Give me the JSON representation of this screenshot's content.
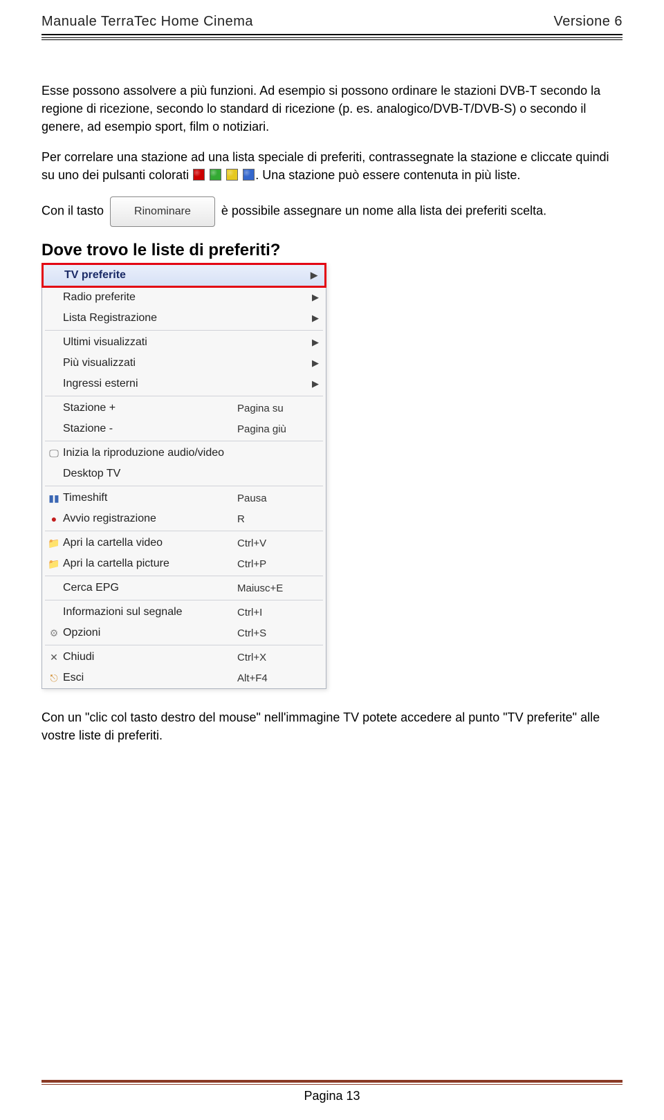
{
  "header": {
    "left": "Manuale TerraTec Home Cinema",
    "right": "Versione 6"
  },
  "paragraphs": {
    "p1": "Esse possono assolvere a più funzioni. Ad esempio si possono ordinare le stazioni DVB-T secondo la regione di ricezione, secondo lo standard di ricezione (p. es. analogico/DVB-T/DVB-S) o secondo il genere, ad esempio sport, film o notiziari.",
    "p2a": "Per correlare una stazione ad una lista speciale di preferiti, contrassegnate la stazione e cliccate quindi su uno dei pulsanti colorati ",
    "p2b": ". Una stazione può essere contenuta in più liste.",
    "p3a": "Con il tasto ",
    "p3b": " è possibile assegnare un nome alla lista dei preferiti scelta."
  },
  "button_label": "Rinominare",
  "heading": "Dove trovo le liste di preferiti?",
  "menu": {
    "tv_preferite": "TV preferite",
    "radio_preferite": "Radio preferite",
    "lista_reg": "Lista Registrazione",
    "ultimi": "Ultimi visualizzati",
    "piu": "Più visualizzati",
    "ingressi": "Ingressi esterni",
    "stazione_plus": "Stazione +",
    "stazione_minus": "Stazione -",
    "pagina_su": "Pagina su",
    "pagina_giu": "Pagina giù",
    "inizia_rip": "Inizia la riproduzione audio/video",
    "desktop_tv": "Desktop TV",
    "timeshift": "Timeshift",
    "avvio_reg": "Avvio registrazione",
    "pausa": "Pausa",
    "r": "R",
    "apri_video": "Apri la cartella video",
    "apri_picture": "Apri la cartella picture",
    "ctrlv": "Ctrl+V",
    "ctrlp": "Ctrl+P",
    "cerca_epg": "Cerca EPG",
    "maiusce": "Maiusc+E",
    "info_segnale": "Informazioni sul segnale",
    "opzioni": "Opzioni",
    "ctrli": "Ctrl+I",
    "ctrls": "Ctrl+S",
    "chiudi": "Chiudi",
    "esci": "Esci",
    "ctrlx": "Ctrl+X",
    "altf4": "Alt+F4"
  },
  "p_after": "Con un \"clic col tasto destro del mouse\" nell'immagine TV potete accedere al punto \"TV preferite\" alle vostre liste di preferiti.",
  "footer": "Pagina 13"
}
